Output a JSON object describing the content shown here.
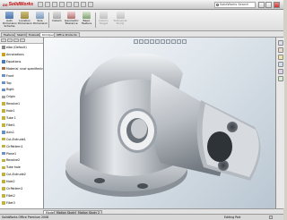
{
  "app": {
    "brand_prefix": "DS",
    "brand": "SolidWorks",
    "search_placeholder": "SolidWorks Search"
  },
  "commands": [
    {
      "label1": "Auto",
      "label2": "Dimension",
      "label3": "Scheme",
      "icon": "auto-dimension-icon"
    },
    {
      "label1": "Location",
      "label2": "Dimension",
      "label3": "",
      "icon": "location-dimension-icon"
    },
    {
      "label1": "Size",
      "label2": "Dimension",
      "label3": "",
      "icon": "size-dimension-icon"
    },
    {
      "label1": "Datum",
      "label2": "",
      "label3": "",
      "icon": "datum-icon"
    },
    {
      "label1": "Geometric",
      "label2": "Tolerance",
      "label3": "",
      "icon": "geometric-tolerance-icon"
    },
    {
      "label1": "Basic",
      "label2": "Feature",
      "label3": "",
      "icon": "basic-feature-icon"
    },
    {
      "label1": "Datum",
      "label2": "Target",
      "label3": "",
      "icon": "datum-target-icon"
    },
    {
      "label1": "TolAnalyst",
      "label2": "Study",
      "label3": "",
      "icon": "tolanalyst-icon"
    }
  ],
  "tabs": [
    "Features",
    "Sketch",
    "Evaluate",
    "DimXpert",
    "Office Products"
  ],
  "active_tab": 3,
  "tree": [
    {
      "label": "elbo (Default)",
      "color": "#8a8a8a"
    },
    {
      "label": "Annotations",
      "color": "#c8a020"
    },
    {
      "label": "Equations",
      "color": "#4a7ab0"
    },
    {
      "label": "Material <not specified>",
      "color": "#a07040"
    },
    {
      "label": "Front",
      "color": "#6a8fc0"
    },
    {
      "label": "Top",
      "color": "#6a8fc0"
    },
    {
      "label": "Right",
      "color": "#6a8fc0"
    },
    {
      "label": "Origin",
      "color": "#a0a0a0"
    },
    {
      "label": "Revolve1",
      "color": "#c0b040"
    },
    {
      "label": "Hole1",
      "color": "#c0b040"
    },
    {
      "label": "Tube 1",
      "color": "#c0b040"
    },
    {
      "label": "Fillet1",
      "color": "#c0b040"
    },
    {
      "label": "Axis1",
      "color": "#6a8fc0"
    },
    {
      "label": "Cut-Extrude1",
      "color": "#c0b040"
    },
    {
      "label": "CirPattern1",
      "color": "#c0b040"
    },
    {
      "label": "Plane1",
      "color": "#6a8fc0"
    },
    {
      "label": "Revolve2",
      "color": "#c0b040"
    },
    {
      "label": "Tube hole",
      "color": "#c0b040"
    },
    {
      "label": "Cut-Extrude2",
      "color": "#c0b040"
    },
    {
      "label": "Hole2",
      "color": "#c0b040"
    },
    {
      "label": "CirPattern2",
      "color": "#c0b040"
    },
    {
      "label": "Fillet2",
      "color": "#c0b040"
    },
    {
      "label": "Fillet3",
      "color": "#c0b040"
    }
  ],
  "bottom_tabs": [
    "Model",
    "Motion Study 1",
    "Motion Study 2"
  ],
  "status": {
    "left": "SolidWorks Office Premium 2008",
    "right": "Editing Part"
  },
  "colors": {
    "brand": "#c00000",
    "viewport_top": "#f7f9fb",
    "viewport_bottom": "#b9c6d1",
    "part_metal": "#c9cdd2"
  }
}
